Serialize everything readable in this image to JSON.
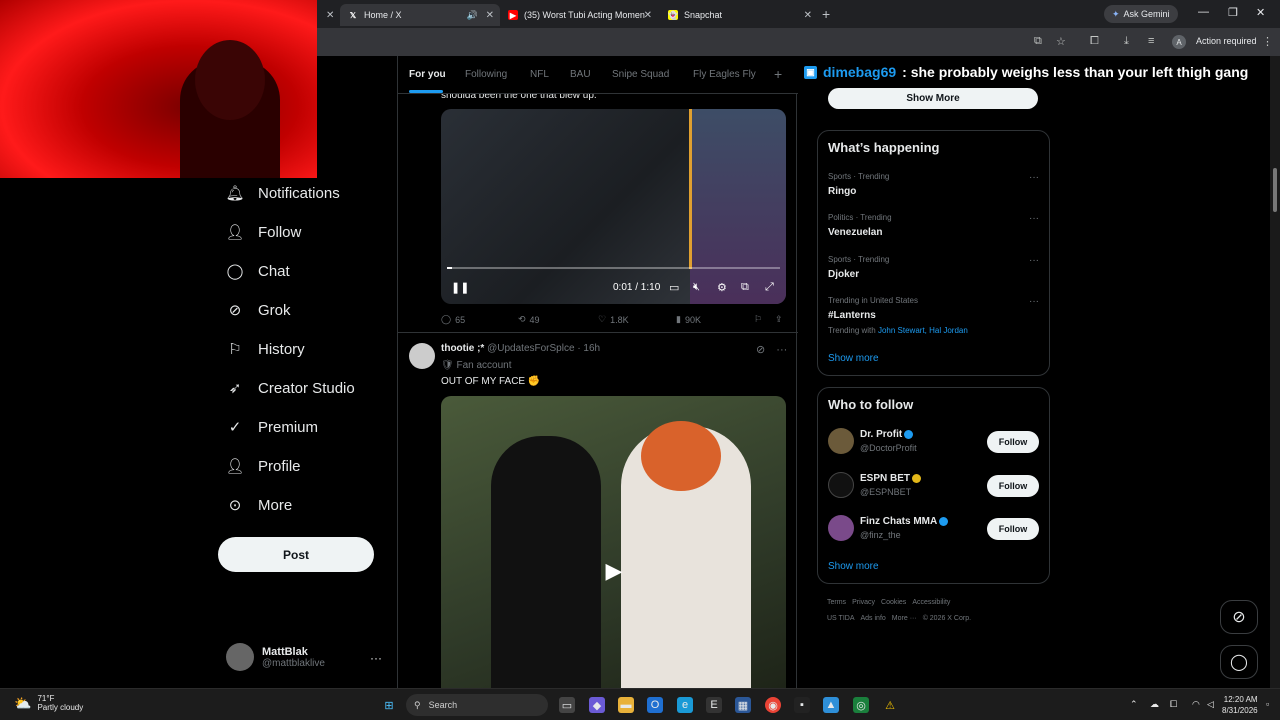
{
  "browser": {
    "tabs": [
      {
        "label": "Home / X",
        "icon": "x-logo-icon"
      },
      {
        "label": "(35) Worst Tubi Acting Momen",
        "icon": "youtube-icon"
      },
      {
        "label": "Snapchat",
        "icon": "snapchat-icon"
      }
    ],
    "gemini_label": "Ask Gemini",
    "action_required": "Action required",
    "profile_initial": "A"
  },
  "nav": {
    "items": [
      {
        "label": "Notifications",
        "icon": "bell-icon"
      },
      {
        "label": "Follow",
        "icon": "person-plus-icon"
      },
      {
        "label": "Chat",
        "icon": "chat-bubble-icon"
      },
      {
        "label": "Grok",
        "icon": "grok-icon"
      },
      {
        "label": "History",
        "icon": "bookmark-icon"
      },
      {
        "label": "Creator Studio",
        "icon": "rocket-icon"
      },
      {
        "label": "Premium",
        "icon": "verified-icon"
      },
      {
        "label": "Profile",
        "icon": "person-icon"
      },
      {
        "label": "More",
        "icon": "more-circle-icon"
      }
    ],
    "post_label": "Post",
    "account": {
      "name": "MattBlak",
      "handle": "@mattblaklive"
    }
  },
  "feed": {
    "tabs": [
      "For you",
      "Following",
      "NFL",
      "BAU",
      "Snipe Squad",
      "Fly Eagles Fly"
    ],
    "tweet1": {
      "text_fragment": "shoulda been the one that blew up.",
      "video_time": "0:01 / 1:10",
      "video_progress": 0.015,
      "replies": "65",
      "reposts": "49",
      "likes": "1.8K",
      "views": "90K"
    },
    "tweet2": {
      "name": "thootie ;*",
      "handle": "@UpdatesForSplce",
      "time": "16h",
      "label": "Fan account",
      "text": "OUT OF MY FACE ✊"
    }
  },
  "sidebar": {
    "banner_user": "dimebag69",
    "banner_text": ": she probably weighs less than your left thigh gang",
    "show_more_button": "Show More",
    "happening": {
      "title": "What’s happening",
      "trends": [
        {
          "meta": "Sports · Trending",
          "topic": "Ringo"
        },
        {
          "meta": "Politics · Trending",
          "topic": "Venezuelan"
        },
        {
          "meta": "Sports · Trending",
          "topic": "Djoker"
        },
        {
          "meta": "Trending in United States",
          "topic": "#Lanterns",
          "with_prefix": "Trending with",
          "with_links": "John Stewart, Hal Jordan"
        }
      ],
      "show_more": "Show more"
    },
    "who_to_follow": {
      "title": "Who to follow",
      "accounts": [
        {
          "name": "Dr. Profit",
          "handle": "@DoctorProfit",
          "badge": "blue"
        },
        {
          "name": "ESPN BET",
          "handle": "@ESPNBET",
          "badge": "gold"
        },
        {
          "name": "Finz Chats MMA",
          "handle": "@finz_the",
          "badge": "blue"
        }
      ],
      "follow_label": "Follow",
      "show_more": "Show more"
    },
    "footer": [
      "Terms",
      "Privacy",
      "Cookies",
      "Accessibility",
      "US TIDA",
      "Ads info",
      "More ···",
      "© 2026 X Corp."
    ]
  },
  "taskbar": {
    "temp": "71°F",
    "weather": "Partly cloudy",
    "search_placeholder": "Search",
    "time": "12:20 AM",
    "date": "8/31/2026"
  },
  "colors": {
    "accent": "#1d9bf0",
    "background": "#000000",
    "border": "#2f3336"
  }
}
